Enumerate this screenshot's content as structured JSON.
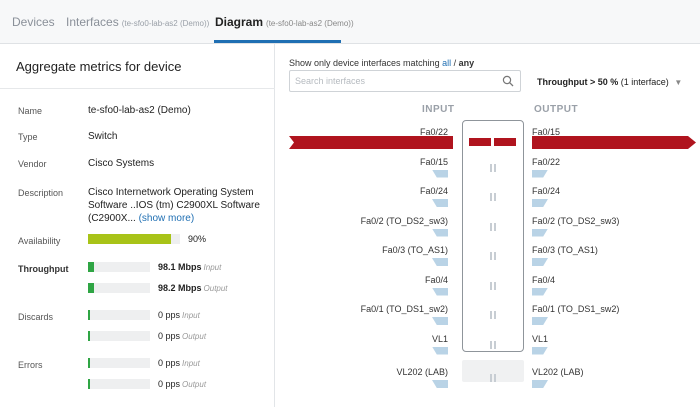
{
  "tabs": [
    {
      "label": "Devices",
      "context": ""
    },
    {
      "label": "Interfaces",
      "context": "(te-sfo0-lab-as2 (Demo))"
    },
    {
      "label": "Diagram",
      "context": "(te-sfo0-lab-as2 (Demo))"
    }
  ],
  "left_panel": {
    "title": "Aggregate metrics for device",
    "name": {
      "label": "Name",
      "value": "te-sfo0-lab-as2 (Demo)"
    },
    "type": {
      "label": "Type",
      "value": "Switch"
    },
    "vendor": {
      "label": "Vendor",
      "value": "Cisco Systems"
    },
    "description": {
      "label": "Description",
      "value": "Cisco Internetwork Operating System Software ..IOS (tm) C2900XL Software (C2900X...",
      "show_more": "(show more)"
    },
    "availability": {
      "label": "Availability",
      "percent_text": "90%",
      "fraction": 0.9,
      "color": "#a8c318"
    },
    "throughput": {
      "label": "Throughput",
      "input": {
        "value": "98.1 Mbps",
        "direction": "Input",
        "fraction": 0.07
      },
      "output": {
        "value": "98.2 Mbps",
        "direction": "Output",
        "fraction": 0.07
      },
      "color": "#2fa544"
    },
    "discards": {
      "label": "Discards",
      "input": {
        "value": "0 pps",
        "direction": "Input"
      },
      "output": {
        "value": "0 pps",
        "direction": "Output"
      }
    },
    "errors": {
      "label": "Errors",
      "input": {
        "value": "0 pps",
        "direction": "Input"
      },
      "output": {
        "value": "0 pps",
        "direction": "Output"
      }
    }
  },
  "filter": {
    "prefix": "Show only device interfaces matching",
    "all_label": "all",
    "separator": "/",
    "any_label": "any",
    "search_placeholder": "Search interfaces",
    "throughput_label": "Throughput > 50 %",
    "throughput_count": "(1 interface)"
  },
  "diagram": {
    "input_header": "INPUT",
    "output_header": "OUTPUT",
    "flow_color": "#b0141e",
    "ports": [
      {
        "input": "Fa0/22",
        "output": "Fa0/15",
        "highlighted": true
      },
      {
        "input": "Fa0/15",
        "output": "Fa0/22",
        "highlighted": false
      },
      {
        "input": "Fa0/24",
        "output": "Fa0/24",
        "highlighted": false
      },
      {
        "input": "Fa0/2 (TO_DS2_sw3)",
        "output": "Fa0/2 (TO_DS2_sw3)",
        "highlighted": false
      },
      {
        "input": "Fa0/3 (TO_AS1)",
        "output": "Fa0/3 (TO_AS1)",
        "highlighted": false
      },
      {
        "input": "Fa0/4",
        "output": "Fa0/4",
        "highlighted": false
      },
      {
        "input": "Fa0/1 (TO_DS1_sw2)",
        "output": "Fa0/1 (TO_DS1_sw2)",
        "highlighted": false
      },
      {
        "input": "VL1",
        "output": "VL1",
        "highlighted": false
      },
      {
        "input": "VL202 (LAB)",
        "output": "VL202 (LAB)",
        "highlighted": false
      }
    ]
  }
}
